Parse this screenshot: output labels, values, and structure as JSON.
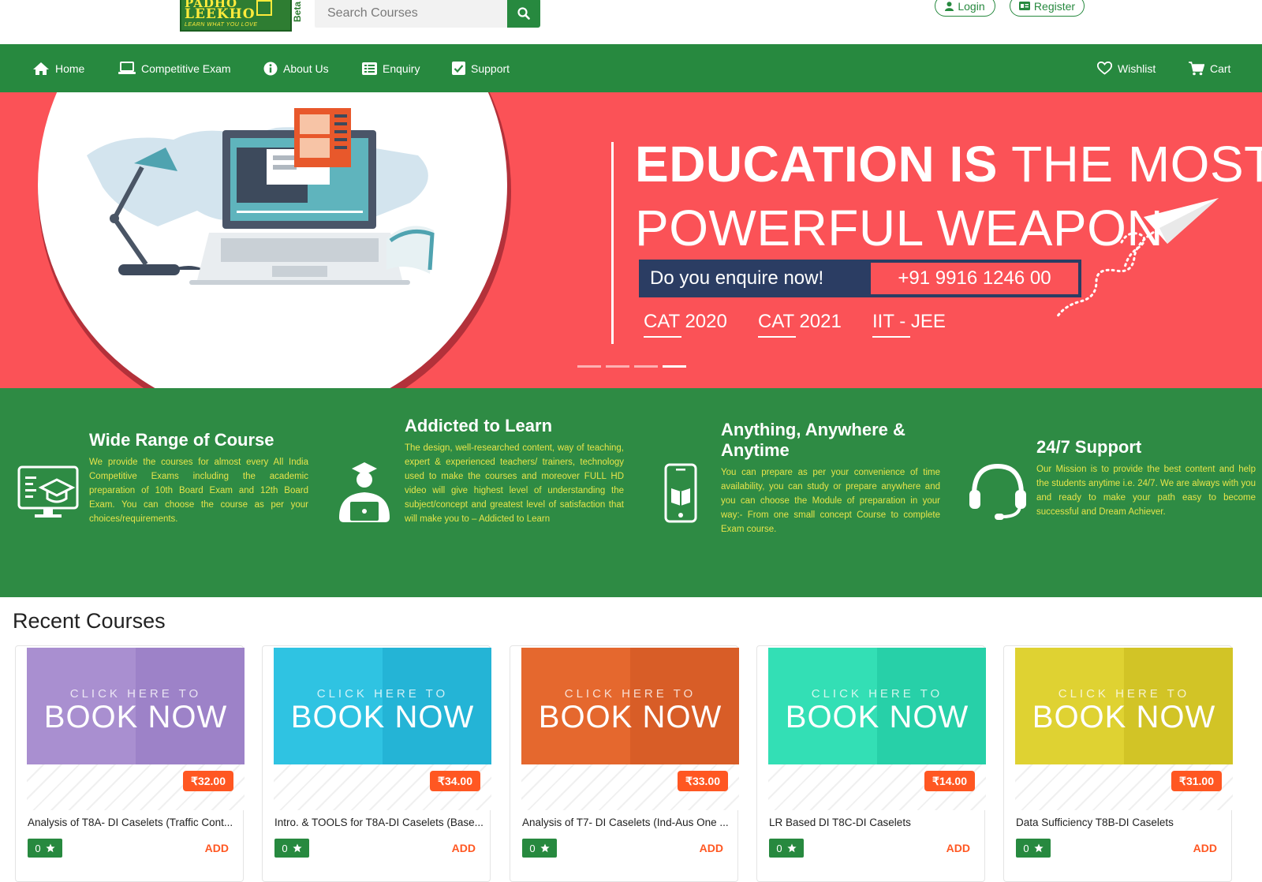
{
  "header": {
    "logo_line1": "PADHO",
    "logo_line2": "LEEKHO",
    "logo_tagline": "LEARN WHAT YOU LOVE",
    "beta_label": "Beta",
    "search_placeholder": "Search Courses",
    "login_label": "Login",
    "register_label": "Register"
  },
  "nav": {
    "items": [
      {
        "label": "Home",
        "icon": "home-icon"
      },
      {
        "label": "Competitive Exam",
        "icon": "laptop-icon"
      },
      {
        "label": "About Us",
        "icon": "info-icon"
      },
      {
        "label": "Enquiry",
        "icon": "list-icon"
      },
      {
        "label": "Support",
        "icon": "support-icon"
      }
    ],
    "wishlist_label": "Wishlist",
    "cart_label": "Cart"
  },
  "hero": {
    "headline_bold": "EDUCATION IS",
    "headline_rest": "THE MOST",
    "headline_line2": "POWERFUL WEAPON",
    "enquire_text": "Do you enquire now!",
    "phone": "+91 9916 1246 00",
    "exams": [
      "CAT 2020",
      "CAT 2021",
      "IIT - JEE"
    ],
    "slide_count": 4,
    "active_slide": 4
  },
  "features": [
    {
      "title": "Wide Range of Course",
      "icon": "monitor-graduation-icon",
      "text": "We provide the courses for almost every All India Competitive Exams including the academic preparation of 10th Board Exam and 12th Board Exam. You can choose the course as per your choices/requirements."
    },
    {
      "title": "Addicted to Learn",
      "icon": "student-laptop-icon",
      "text": "The design, well-researched content, way of teaching, expert & experienced teachers/ trainers, technology used to make the courses and moreover FULL HD video will give highest level of understanding the subject/concept and greatest level of satisfaction that will make you to – Addicted to Learn"
    },
    {
      "title": "Anything, Anywhere & Anytime",
      "icon": "mobile-book-icon",
      "text": "You can prepare as per your convenience of time availability, you can study or prepare anywhere and you can choose the Module of preparation in your way:- From one small concept Course to complete Exam course."
    },
    {
      "title": "24/7 Support",
      "icon": "headset-icon",
      "text": "Our Mission is to provide the best content and help the students anytime i.e. 24/7. We are always with you and ready to make your path easy to become successful and Dream Achiever."
    }
  ],
  "recent": {
    "title": "Recent Courses",
    "banner_small": "CLICK HERE TO",
    "banner_big": "BOOK NOW",
    "add_label": "ADD",
    "courses": [
      {
        "name": "Analysis of T8A- DI Caselets (Traffic Cont...",
        "price": "₹32.00",
        "rating": "0",
        "color": "#a98fd0",
        "dark": "#9d82c8"
      },
      {
        "name": "Intro. & TOOLS for T8A-DI Caselets (Base...",
        "price": "₹34.00",
        "rating": "0",
        "color": "#2fc3e2",
        "dark": "#24b4d6"
      },
      {
        "name": "Analysis of T7- DI Caselets (Ind-Aus One ...",
        "price": "₹33.00",
        "rating": "0",
        "color": "#e5682e",
        "dark": "#d85d27"
      },
      {
        "name": "LR Based DI T8C-DI Caselets",
        "price": "₹14.00",
        "rating": "0",
        "color": "#33dfb5",
        "dark": "#27d0a8"
      },
      {
        "name": "Data Sufficiency T8B-DI Caselets",
        "price": "₹31.00",
        "rating": "0",
        "color": "#dfd232",
        "dark": "#d2c426"
      }
    ]
  }
}
